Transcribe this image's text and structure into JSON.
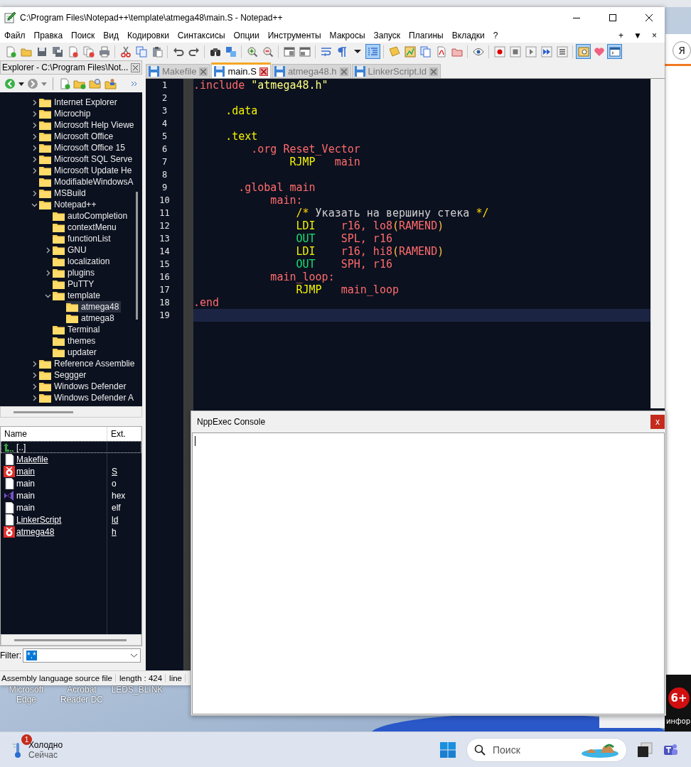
{
  "window": {
    "title": "C:\\Program Files\\Notepad++\\template\\atmega48\\main.S - Notepad++"
  },
  "menu": [
    "Файл",
    "Правка",
    "Поиск",
    "Вид",
    "Кодировки",
    "Синтаксисы",
    "Опции",
    "Инструменты",
    "Макросы",
    "Запуск",
    "Плагины",
    "Вкладки",
    "?"
  ],
  "menu_controls": [
    "+",
    "▼",
    "×"
  ],
  "toolbar": [
    {
      "kind": "new",
      "pressed": false
    },
    {
      "kind": "open",
      "pressed": false
    },
    {
      "kind": "save",
      "pressed": false
    },
    {
      "kind": "saveall",
      "pressed": false
    },
    {
      "kind": "close",
      "pressed": false
    },
    {
      "kind": "closeall",
      "pressed": false
    },
    {
      "kind": "print",
      "pressed": false
    },
    {
      "kind": "sep"
    },
    {
      "kind": "cut",
      "pressed": false
    },
    {
      "kind": "copy",
      "pressed": false
    },
    {
      "kind": "paste",
      "pressed": false
    },
    {
      "kind": "sep"
    },
    {
      "kind": "undo",
      "pressed": false
    },
    {
      "kind": "redo",
      "pressed": false
    },
    {
      "kind": "sep"
    },
    {
      "kind": "find",
      "pressed": false
    },
    {
      "kind": "replace",
      "pressed": false
    },
    {
      "kind": "sep"
    },
    {
      "kind": "zoomin",
      "pressed": false
    },
    {
      "kind": "zoomout",
      "pressed": false
    },
    {
      "kind": "sep"
    },
    {
      "kind": "syncv",
      "pressed": false
    },
    {
      "kind": "synch",
      "pressed": false
    },
    {
      "kind": "sep"
    },
    {
      "kind": "wrap",
      "pressed": false
    },
    {
      "kind": "pilcrow",
      "pressed": false
    },
    {
      "kind": "caret",
      "pressed": false
    },
    {
      "kind": "guide",
      "pressed": true
    },
    {
      "kind": "sep"
    },
    {
      "kind": "note",
      "pressed": false
    },
    {
      "kind": "map",
      "pressed": false
    },
    {
      "kind": "pages",
      "pressed": false
    },
    {
      "kind": "pdf",
      "pressed": false
    },
    {
      "kind": "folder",
      "pressed": false
    },
    {
      "kind": "sep"
    },
    {
      "kind": "eye",
      "pressed": false
    },
    {
      "kind": "sep"
    },
    {
      "kind": "record",
      "pressed": false
    },
    {
      "kind": "stop",
      "pressed": false
    },
    {
      "kind": "play",
      "pressed": false
    },
    {
      "kind": "ffwd",
      "pressed": false
    },
    {
      "kind": "list",
      "pressed": false
    },
    {
      "kind": "sep"
    },
    {
      "kind": "panel",
      "pressed": true
    },
    {
      "kind": "heart",
      "pressed": false
    },
    {
      "kind": "console",
      "pressed": true
    }
  ],
  "explorer": {
    "title": "Explorer - C:\\Program Files\\Not...",
    "tree": [
      {
        "label": "Internet Explorer",
        "expandable": true,
        "expanded": false,
        "selected": false
      },
      {
        "label": "Microchip",
        "expandable": true,
        "expanded": false,
        "selected": false
      },
      {
        "label": "Microsoft Help Viewe",
        "expandable": true,
        "expanded": false,
        "selected": false
      },
      {
        "label": "Microsoft Office",
        "expandable": true,
        "expanded": false,
        "selected": false
      },
      {
        "label": "Microsoft Office 15",
        "expandable": true,
        "expanded": false,
        "selected": false
      },
      {
        "label": "Microsoft SQL Serve",
        "expandable": true,
        "expanded": false,
        "selected": false
      },
      {
        "label": "Microsoft Update He",
        "expandable": true,
        "expanded": false,
        "selected": false
      },
      {
        "label": "ModifiableWindowsA",
        "expandable": false,
        "expanded": false,
        "selected": false
      },
      {
        "label": "MSBuild",
        "expandable": true,
        "expanded": false,
        "selected": false
      },
      {
        "label": "Notepad++",
        "expandable": true,
        "expanded": true,
        "selected": false,
        "children": [
          {
            "label": "autoCompletion",
            "expandable": false,
            "expanded": false,
            "selected": false
          },
          {
            "label": "contextMenu",
            "expandable": false,
            "expanded": false,
            "selected": false
          },
          {
            "label": "functionList",
            "expandable": false,
            "expanded": false,
            "selected": false
          },
          {
            "label": "GNU",
            "expandable": true,
            "expanded": false,
            "selected": false
          },
          {
            "label": "localization",
            "expandable": false,
            "expanded": false,
            "selected": false
          },
          {
            "label": "plugins",
            "expandable": true,
            "expanded": false,
            "selected": false
          },
          {
            "label": "PuTTY",
            "expandable": false,
            "expanded": false,
            "selected": false
          },
          {
            "label": "template",
            "expandable": true,
            "expanded": true,
            "selected": false,
            "children": [
              {
                "label": "atmega48",
                "expandable": false,
                "expanded": false,
                "selected": true
              },
              {
                "label": "atmega8",
                "expandable": false,
                "expanded": false,
                "selected": false
              }
            ]
          },
          {
            "label": "Terminal",
            "expandable": false,
            "expanded": false,
            "selected": false
          },
          {
            "label": "themes",
            "expandable": false,
            "expanded": false,
            "selected": false
          },
          {
            "label": "updater",
            "expandable": false,
            "expanded": false,
            "selected": false
          }
        ]
      },
      {
        "label": "Reference Assemblie",
        "expandable": true,
        "expanded": false,
        "selected": false
      },
      {
        "label": "Seggger",
        "expandable": true,
        "expanded": false,
        "selected": false
      },
      {
        "label": "Windows Defender",
        "expandable": true,
        "expanded": false,
        "selected": false
      },
      {
        "label": "Windows Defender A",
        "expandable": true,
        "expanded": false,
        "selected": false
      }
    ],
    "columns": [
      "Name",
      "Ext."
    ],
    "files": [
      {
        "name": "[..]",
        "kind": "up",
        "linked": false,
        "selected": true
      },
      {
        "name": "Makefile",
        "kind": "file",
        "linked": true,
        "selected": false
      },
      {
        "name": "main",
        "ext": "S",
        "kind": "avr",
        "linked": true,
        "selected": false
      },
      {
        "name": "main",
        "ext": "o",
        "kind": "file",
        "linked": false,
        "selected": false
      },
      {
        "name": "main",
        "ext": "hex",
        "kind": "vs",
        "linked": false,
        "selected": false
      },
      {
        "name": "main",
        "ext": "elf",
        "kind": "file",
        "linked": false,
        "selected": false
      },
      {
        "name": "LinkerScript",
        "ext": "ld",
        "kind": "file",
        "linked": true,
        "selected": false
      },
      {
        "name": "atmega48",
        "ext": "h",
        "kind": "avr",
        "linked": true,
        "selected": false
      }
    ],
    "filter": {
      "label": "Filter:",
      "value": "*.*"
    }
  },
  "tabs": [
    {
      "label": "Makefile",
      "selected": false
    },
    {
      "label": "main.S",
      "selected": true
    },
    {
      "label": "atmega48.h",
      "selected": false
    },
    {
      "label": "LinkerScript.ld",
      "selected": false
    }
  ],
  "editor": {
    "lines": [
      {
        "number": "1",
        "current": false,
        "tokens": [
          {
            "text": ".include",
            "kind": "directive"
          },
          {
            "text": " \"atmega48.h\"",
            "kind": "string"
          }
        ]
      },
      {
        "number": "2",
        "current": false
      },
      {
        "number": "3",
        "current": false,
        "tokens": [
          {
            "text": "     .data",
            "kind": "section"
          }
        ]
      },
      {
        "number": "4",
        "current": false
      },
      {
        "number": "5",
        "current": false,
        "tokens": [
          {
            "text": "     .text",
            "kind": "section"
          }
        ]
      },
      {
        "number": "6",
        "current": false,
        "tokens": [
          {
            "text": "         .org Reset_Vector",
            "kind": "directive"
          }
        ]
      },
      {
        "number": "7",
        "current": false,
        "tokens": [
          {
            "text": "               RJMP",
            "kind": "instruction"
          },
          {
            "text": "   main",
            "kind": "operand"
          }
        ]
      },
      {
        "number": "8",
        "current": false
      },
      {
        "number": "9",
        "current": false,
        "tokens": [
          {
            "text": "       .global main",
            "kind": "directive"
          }
        ]
      },
      {
        "number": "10",
        "current": false,
        "tokens": [
          {
            "text": "            main:",
            "kind": "operand"
          }
        ]
      },
      {
        "number": "11",
        "current": false,
        "tokens": [
          {
            "text": "                /*",
            "kind": "mark"
          },
          {
            "text": " Указать на вершину стека ",
            "kind": "comment"
          },
          {
            "text": "*/",
            "kind": "mark"
          }
        ]
      },
      {
        "number": "12",
        "current": false,
        "tokens": [
          {
            "text": "                LDI",
            "kind": "instruction"
          },
          {
            "text": "    r16, lo8",
            "kind": "operand"
          },
          {
            "text": "(",
            "kind": "paren"
          },
          {
            "text": "RAMEND",
            "kind": "operand"
          },
          {
            "text": ")",
            "kind": "paren"
          }
        ]
      },
      {
        "number": "13",
        "current": false,
        "tokens": [
          {
            "text": "                OUT",
            "kind": "io"
          },
          {
            "text": "    SPL, r16",
            "kind": "operand"
          }
        ]
      },
      {
        "number": "14",
        "current": false,
        "tokens": [
          {
            "text": "                LDI",
            "kind": "instruction"
          },
          {
            "text": "    r16, hi8",
            "kind": "operand"
          },
          {
            "text": "(",
            "kind": "paren"
          },
          {
            "text": "RAMEND",
            "kind": "operand"
          },
          {
            "text": ")",
            "kind": "paren"
          }
        ]
      },
      {
        "number": "15",
        "current": false,
        "tokens": [
          {
            "text": "                OUT",
            "kind": "io"
          },
          {
            "text": "    SPH, r16",
            "kind": "operand"
          }
        ]
      },
      {
        "number": "16",
        "current": false,
        "tokens": [
          {
            "text": "            main_loop:",
            "kind": "operand"
          }
        ]
      },
      {
        "number": "17",
        "current": false,
        "tokens": [
          {
            "text": "                RJMP",
            "kind": "instruction"
          },
          {
            "text": "   main_loop",
            "kind": "operand"
          }
        ]
      },
      {
        "number": "18",
        "current": false,
        "tokens": [
          {
            "text": ".end",
            "kind": "directive"
          }
        ]
      },
      {
        "number": "19",
        "current": true
      }
    ]
  },
  "status_bar": [
    "Assembly language source file",
    "length : 424",
    "line"
  ],
  "console": {
    "title": "NppExec Console",
    "close": "x"
  },
  "desktop_icons": [
    {
      "lines": [
        "Microsoft",
        "Edge"
      ]
    },
    {
      "lines": [
        "Acrobat",
        "Reader DC"
      ]
    },
    {
      "lines": [
        "LEDS_BLINK"
      ]
    }
  ],
  "browser": {
    "profile": "Я",
    "badge": "6+",
    "caption": "инфор"
  },
  "taskbar": {
    "weather": {
      "badge": "1",
      "title": "Холодно",
      "subtitle": "Сейчас"
    },
    "search": {
      "placeholder": "Поиск"
    }
  }
}
